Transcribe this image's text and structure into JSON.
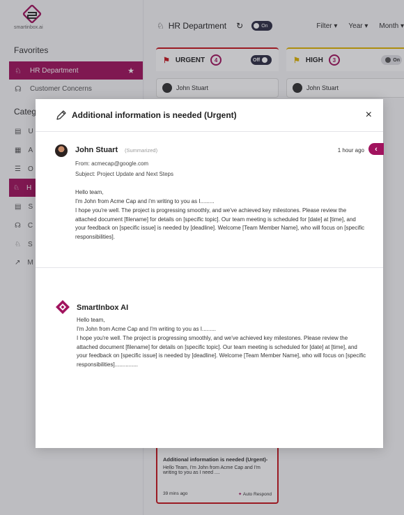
{
  "sidebar": {
    "logo_text": "smartinbox.ai",
    "favorites_title": "Favorites",
    "favorites": [
      {
        "label": "HR Department",
        "icon": "people-icon",
        "active": true
      },
      {
        "label": "Customer Concerns",
        "icon": "headset-icon",
        "active": false
      }
    ],
    "categories_title": "Categ",
    "categories": [
      "U",
      "A",
      "O",
      "H",
      "S",
      "C",
      "S",
      "M"
    ]
  },
  "main": {
    "title": "HR Department",
    "toggle_label": "On",
    "filters": [
      "Filter ▾",
      "Year ▾",
      "Month ▾"
    ],
    "columns": [
      {
        "label": "URGENT",
        "count": "4",
        "toggle": "Off",
        "flag_color": "#c7161e"
      },
      {
        "label": "HIGH",
        "count": "3",
        "toggle": "On",
        "flag_color": "#e0b400"
      }
    ],
    "card_name": "John Stuart",
    "bottom_card": {
      "title": "Additional information is needed (Urgent)-",
      "preview": "Hello Team, I'm John from Acme Cap and I'm writing to you as I need ....",
      "time": "39 mins ago",
      "action": "Auto Respond"
    }
  },
  "modal": {
    "title": "Additional information is needed (Urgent)",
    "close": "×",
    "email": {
      "sender": "John Stuart",
      "tag": "(Summarized)",
      "time": "1 hour ago",
      "from": "From: acmecap@google.com",
      "subject": "Subject: Project Update and Next Steps",
      "greeting": "Hello team,",
      "line1": "I'm John from Acme Cap and i'm writing to you as I.........",
      "paragraph": "I hope you're well. The project is progressing smoothly, and we've achieved key milestones. Please review the attached document [filename] for details on [specific topic]. Our team meeting is scheduled for [date] at [time], and your feedback on [specific issue] is needed by [deadline]. Welcome [Team Member Name], who will focus on [specific responsibilities]."
    },
    "ai": {
      "name": "SmartInbox AI",
      "greeting": "Hello team,",
      "line1": "I'm John from Acme Cap and I'm writing to you as I.........",
      "paragraph": "I hope you're well. The project is progressing smoothly, and we've achieved key milestones. Please review the attached document [filename] for details on [specific topic]. Our team meeting is scheduled for [date] at [time], and your feedback on [specific issue] is needed by [deadline]. Welcome [Team Member Name], who will focus on [specific responsibilities]..............."
    }
  },
  "colors": {
    "accent": "#a1135e",
    "urgent": "#c7161e",
    "high": "#e0b400"
  }
}
